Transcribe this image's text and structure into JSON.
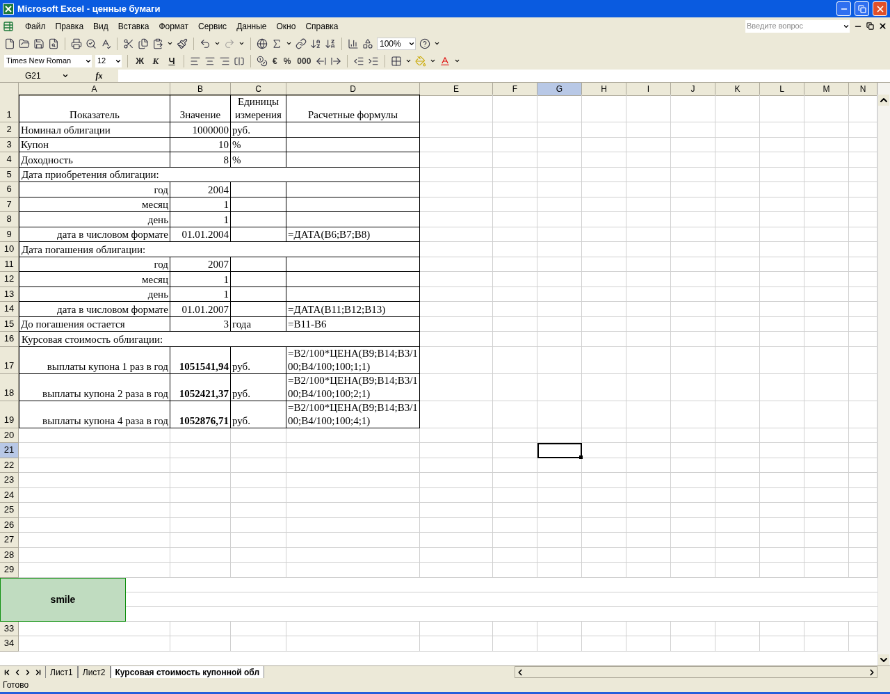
{
  "window": {
    "title": "Microsoft Excel - ценные бумаги"
  },
  "menu": [
    "Файл",
    "Правка",
    "Вид",
    "Вставка",
    "Формат",
    "Сервис",
    "Данные",
    "Окно",
    "Справка"
  ],
  "help_box": {
    "placeholder": "Введите вопрос"
  },
  "standard_toolbar": {
    "zoom": "100%"
  },
  "format_toolbar": {
    "font": "Times New Roman",
    "size": "12",
    "style_buttons": [
      "Ж",
      "К",
      "Ч"
    ],
    "number_buttons": [
      "€",
      "%",
      "000"
    ]
  },
  "formula_bar": {
    "name_box": "G21",
    "fx": "fx"
  },
  "columns": [
    {
      "label": "A",
      "selected": false
    },
    {
      "label": "B",
      "selected": false
    },
    {
      "label": "C",
      "selected": false
    },
    {
      "label": "D",
      "selected": false
    },
    {
      "label": "E",
      "selected": false
    },
    {
      "label": "F",
      "selected": false
    },
    {
      "label": "G",
      "selected": true
    },
    {
      "label": "H",
      "selected": false
    },
    {
      "label": "I",
      "selected": false
    },
    {
      "label": "J",
      "selected": false
    },
    {
      "label": "K",
      "selected": false
    },
    {
      "label": "L",
      "selected": false
    },
    {
      "label": "M",
      "selected": false
    },
    {
      "label": "N",
      "selected": false
    }
  ],
  "rows": [
    {
      "header": "1",
      "selected": false,
      "kind": "header",
      "cells": [
        "Показатель",
        "Значение",
        "Единицы измерения",
        "Расчетные формулы"
      ]
    },
    {
      "header": "2",
      "selected": false,
      "kind": "item",
      "cells": [
        "Номинал облигации",
        "1000000",
        "руб.",
        null
      ]
    },
    {
      "header": "3",
      "selected": false,
      "kind": "item",
      "cells": [
        "Купон",
        "10",
        "%",
        null
      ]
    },
    {
      "header": "4",
      "selected": false,
      "kind": "item",
      "cells": [
        "Доходность",
        "8",
        "%",
        null
      ]
    },
    {
      "header": "5",
      "selected": false,
      "kind": "section",
      "cells": [
        "Дата приобретения облигации:"
      ]
    },
    {
      "header": "6",
      "selected": false,
      "kind": "subitem",
      "cells": [
        "год",
        "2004",
        null,
        null
      ]
    },
    {
      "header": "7",
      "selected": false,
      "kind": "subitem",
      "cells": [
        "месяц",
        "1",
        null,
        null
      ]
    },
    {
      "header": "8",
      "selected": false,
      "kind": "subitem",
      "cells": [
        "день",
        "1",
        null,
        null
      ]
    },
    {
      "header": "9",
      "selected": false,
      "kind": "subitem",
      "cells": [
        "дата в числовом формате",
        "01.01.2004",
        null,
        "=ДАТА(B6;B7;B8)"
      ]
    },
    {
      "header": "10",
      "selected": false,
      "kind": "section",
      "cells": [
        "Дата погашения облигации:"
      ]
    },
    {
      "header": "11",
      "selected": false,
      "kind": "subitem",
      "cells": [
        "год",
        "2007",
        null,
        null
      ]
    },
    {
      "header": "12",
      "selected": false,
      "kind": "subitem",
      "cells": [
        "месяц",
        "1",
        null,
        null
      ]
    },
    {
      "header": "13",
      "selected": false,
      "kind": "subitem",
      "cells": [
        "день",
        "1",
        null,
        null
      ]
    },
    {
      "header": "14",
      "selected": false,
      "kind": "subitem",
      "cells": [
        "дата в числовом формате",
        "01.01.2007",
        null,
        "=ДАТА(B11;B12;B13)"
      ]
    },
    {
      "header": "15",
      "selected": false,
      "kind": "item",
      "cells": [
        "До погашения остается",
        "3",
        "года",
        "=B11-B6"
      ]
    },
    {
      "header": "16",
      "selected": false,
      "kind": "section",
      "cells": [
        "Курсовая стоимость облигации:"
      ]
    },
    {
      "header": "17",
      "selected": false,
      "kind": "result",
      "cells": [
        "выплаты купона 1 раз в год",
        "1051541,94",
        "руб.",
        "=B2/100*ЦЕНА(B9;B14;B3/100;B4/100;100;1;1)"
      ]
    },
    {
      "header": "18",
      "selected": false,
      "kind": "result",
      "cells": [
        "выплаты купона 2 раза в год",
        "1052421,37",
        "руб.",
        "=B2/100*ЦЕНА(B9;B14;B3/100;B4/100;100;2;1)"
      ]
    },
    {
      "header": "19",
      "selected": false,
      "kind": "result",
      "cells": [
        "выплаты купона 4 раза в год",
        "1052876,71",
        "руб.",
        "=B2/100*ЦЕНА(B9;B14;B3/100;B4/100;100;4;1)"
      ]
    },
    {
      "header": "20",
      "selected": false,
      "kind": "empty"
    },
    {
      "header": "21",
      "selected": true,
      "kind": "empty"
    },
    {
      "header": "22",
      "selected": false,
      "kind": "empty"
    },
    {
      "header": "23",
      "selected": false,
      "kind": "empty"
    },
    {
      "header": "24",
      "selected": false,
      "kind": "empty"
    },
    {
      "header": "25",
      "selected": false,
      "kind": "empty"
    },
    {
      "header": "26",
      "selected": false,
      "kind": "empty"
    },
    {
      "header": "27",
      "selected": false,
      "kind": "empty"
    },
    {
      "header": "28",
      "selected": false,
      "kind": "empty"
    },
    {
      "header": "29",
      "selected": false,
      "kind": "empty"
    },
    {
      "kind": "shape",
      "label": "smile"
    },
    {
      "header": "33",
      "selected": false,
      "kind": "empty"
    },
    {
      "header": "34",
      "selected": false,
      "kind": "empty"
    }
  ],
  "sheet_tabs": [
    {
      "label": "Лист1",
      "selected": false
    },
    {
      "label": "Лист2",
      "selected": false
    },
    {
      "label": "Курсовая стоимость купонной обл",
      "selected": true
    }
  ],
  "status_bar": {
    "text": "Готово"
  }
}
